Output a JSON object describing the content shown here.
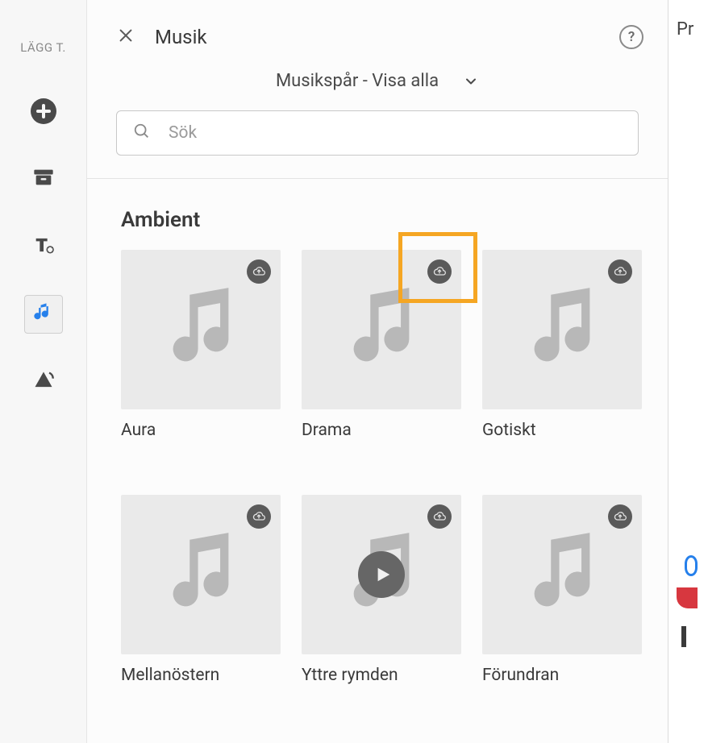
{
  "sidebar": {
    "title": "LÄGG T.",
    "items": [
      {
        "name": "add-media",
        "icon": "plus-circle-icon",
        "selected": false
      },
      {
        "name": "archive",
        "icon": "archive-icon",
        "selected": false
      },
      {
        "name": "add-text",
        "icon": "text-tool-icon",
        "selected": false
      },
      {
        "name": "music",
        "icon": "music-note-icon",
        "selected": true
      },
      {
        "name": "transform",
        "icon": "shape-rotate-icon",
        "selected": false
      }
    ]
  },
  "panel": {
    "title": "Musik",
    "filter_label": "Musikspår - Visa alla",
    "search_placeholder": "Sök",
    "help_tooltip": "?"
  },
  "category": {
    "title": "Ambient",
    "tracks": [
      {
        "label": "Aura",
        "cloud": true,
        "play_visible": false
      },
      {
        "label": "Drama",
        "cloud": true,
        "play_visible": false,
        "highlighted": true
      },
      {
        "label": "Gotiskt",
        "cloud": true,
        "play_visible": false
      },
      {
        "label": "Mellanöstern",
        "cloud": true,
        "play_visible": false
      },
      {
        "label": "Yttre rymden",
        "cloud": true,
        "play_visible": true
      },
      {
        "label": "Förundran",
        "cloud": true,
        "play_visible": false
      }
    ]
  },
  "right_panel": {
    "label_fragment": "Pr"
  }
}
